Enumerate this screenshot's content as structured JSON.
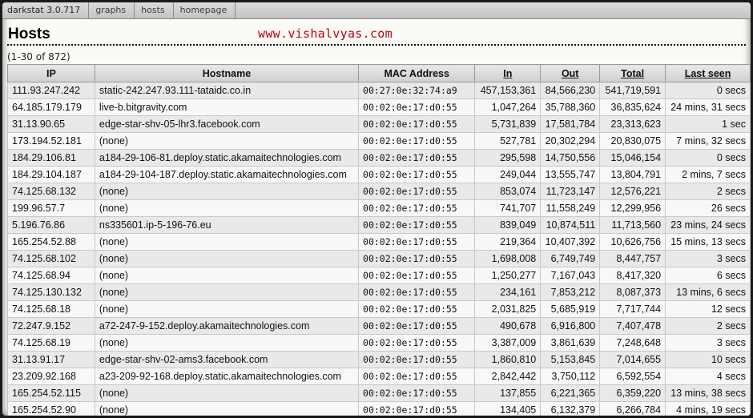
{
  "nav": {
    "brand": "darkstat 3.0.717",
    "links": [
      "graphs",
      "hosts",
      "homepage"
    ]
  },
  "page": {
    "title": "Hosts",
    "watermark": "www.vishalvyas.com",
    "count": "(1-30 of 872)"
  },
  "table": {
    "columns": [
      "IP",
      "Hostname",
      "MAC Address",
      "In",
      "Out",
      "Total",
      "Last seen"
    ],
    "sortable_columns": [
      "In",
      "Out",
      "Total",
      "Last seen"
    ],
    "rows": [
      [
        "111.93.247.242",
        "static-242.247.93.111-tataidc.co.in",
        "00:27:0e:32:74:a9",
        "457,153,361",
        "84,566,230",
        "541,719,591",
        "0 secs"
      ],
      [
        "64.185.179.179",
        "live-b.bitgravity.com",
        "00:02:0e:17:d0:55",
        "1,047,264",
        "35,788,360",
        "36,835,624",
        "24 mins, 31 secs"
      ],
      [
        "31.13.90.65",
        "edge-star-shv-05-lhr3.facebook.com",
        "00:02:0e:17:d0:55",
        "5,731,839",
        "17,581,784",
        "23,313,623",
        "1 sec"
      ],
      [
        "173.194.52.181",
        "(none)",
        "00:02:0e:17:d0:55",
        "527,781",
        "20,302,294",
        "20,830,075",
        "7 mins, 32 secs"
      ],
      [
        "184.29.106.81",
        "a184-29-106-81.deploy.static.akamaitechnologies.com",
        "00:02:0e:17:d0:55",
        "295,598",
        "14,750,556",
        "15,046,154",
        "0 secs"
      ],
      [
        "184.29.104.187",
        "a184-29-104-187.deploy.static.akamaitechnologies.com",
        "00:02:0e:17:d0:55",
        "249,044",
        "13,555,747",
        "13,804,791",
        "2 mins, 7 secs"
      ],
      [
        "74.125.68.132",
        "(none)",
        "00:02:0e:17:d0:55",
        "853,074",
        "11,723,147",
        "12,576,221",
        "2 secs"
      ],
      [
        "199.96.57.7",
        "(none)",
        "00:02:0e:17:d0:55",
        "741,707",
        "11,558,249",
        "12,299,956",
        "26 secs"
      ],
      [
        "5.196.76.86",
        "ns335601.ip-5-196-76.eu",
        "00:02:0e:17:d0:55",
        "839,049",
        "10,874,511",
        "11,713,560",
        "23 mins, 24 secs"
      ],
      [
        "165.254.52.88",
        "(none)",
        "00:02:0e:17:d0:55",
        "219,364",
        "10,407,392",
        "10,626,756",
        "15 mins, 13 secs"
      ],
      [
        "74.125.68.102",
        "(none)",
        "00:02:0e:17:d0:55",
        "1,698,008",
        "6,749,749",
        "8,447,757",
        "3 secs"
      ],
      [
        "74.125.68.94",
        "(none)",
        "00:02:0e:17:d0:55",
        "1,250,277",
        "7,167,043",
        "8,417,320",
        "6 secs"
      ],
      [
        "74.125.130.132",
        "(none)",
        "00:02:0e:17:d0:55",
        "234,161",
        "7,853,212",
        "8,087,373",
        "13 mins, 6 secs"
      ],
      [
        "74.125.68.18",
        "(none)",
        "00:02:0e:17:d0:55",
        "2,031,825",
        "5,685,919",
        "7,717,744",
        "12 secs"
      ],
      [
        "72.247.9.152",
        "a72-247-9-152.deploy.akamaitechnologies.com",
        "00:02:0e:17:d0:55",
        "490,678",
        "6,916,800",
        "7,407,478",
        "2 secs"
      ],
      [
        "74.125.68.19",
        "(none)",
        "00:02:0e:17:d0:55",
        "3,387,009",
        "3,861,639",
        "7,248,648",
        "3 secs"
      ],
      [
        "31.13.91.17",
        "edge-star-shv-02-ams3.facebook.com",
        "00:02:0e:17:d0:55",
        "1,860,810",
        "5,153,845",
        "7,014,655",
        "10 secs"
      ],
      [
        "23.209.92.168",
        "a23-209-92-168.deploy.static.akamaitechnologies.com",
        "00:02:0e:17:d0:55",
        "2,842,442",
        "3,750,112",
        "6,592,554",
        "4 secs"
      ],
      [
        "165.254.52.115",
        "(none)",
        "00:02:0e:17:d0:55",
        "137,855",
        "6,221,365",
        "6,359,220",
        "13 mins, 38 secs"
      ],
      [
        "165.254.52.90",
        "(none)",
        "00:02:0e:17:d0:55",
        "134,405",
        "6,132,379",
        "6,266,784",
        "4 mins, 19 secs"
      ]
    ]
  }
}
